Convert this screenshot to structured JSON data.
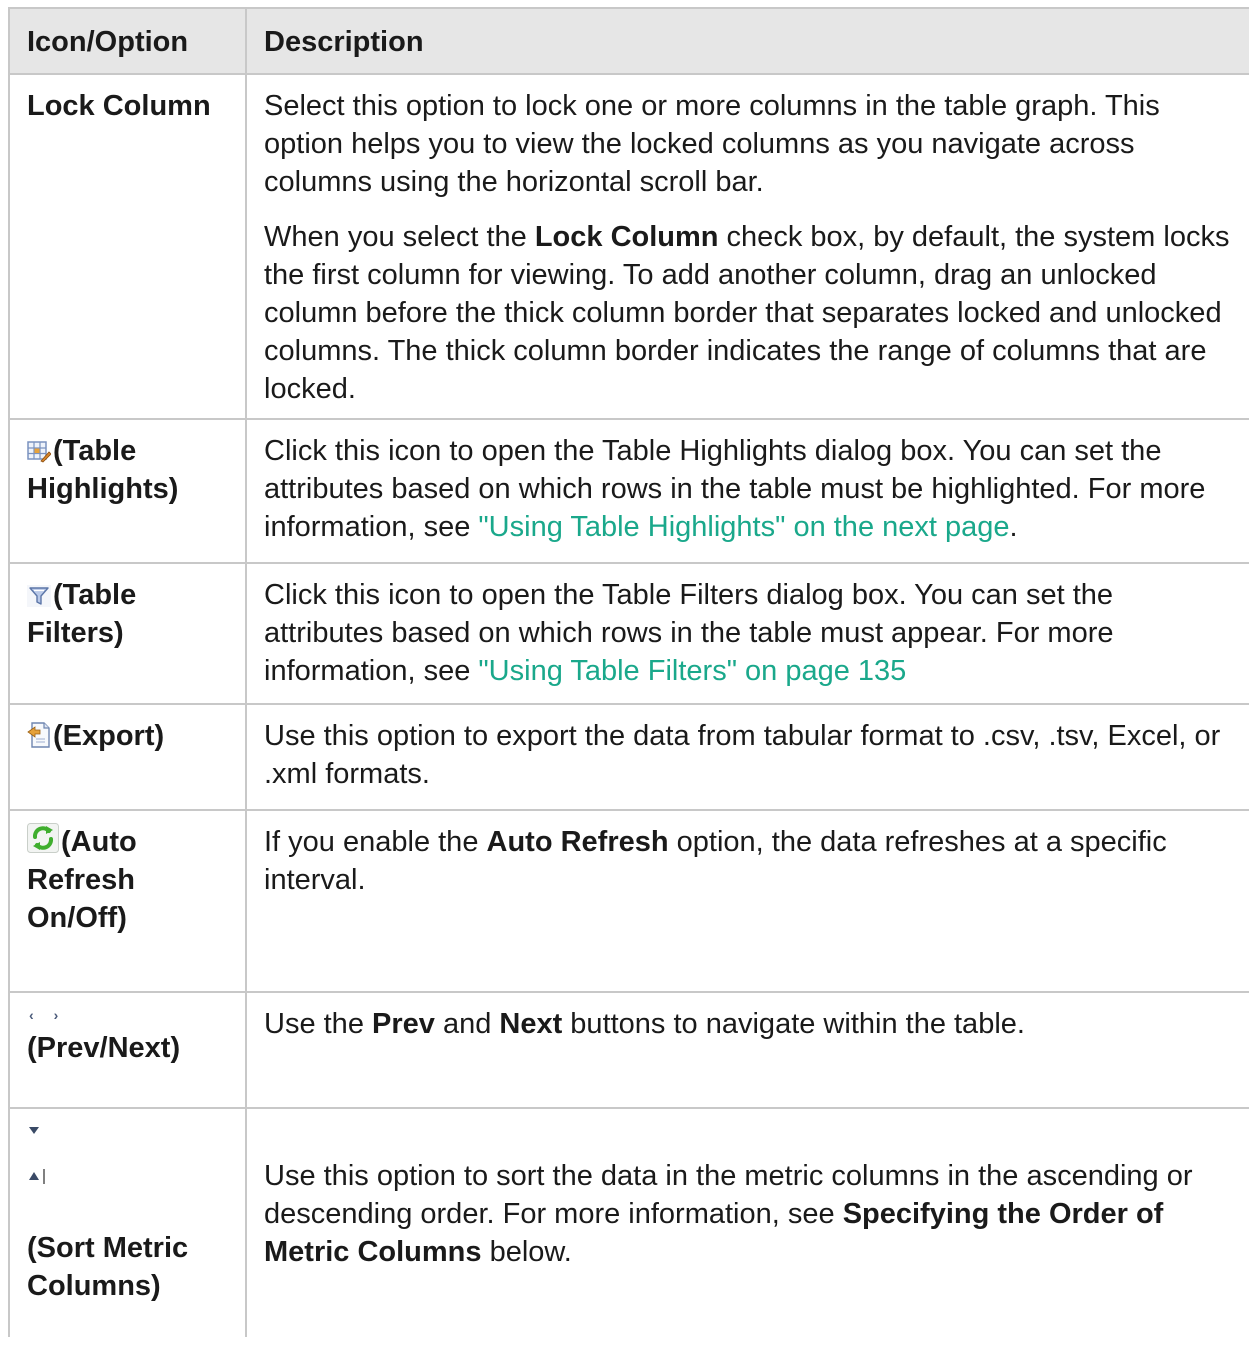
{
  "header": {
    "col1": "Icon/Option",
    "col2": "Description"
  },
  "rows": [
    {
      "option": "Lock Column",
      "p1": "Select this option to lock one or more columns in the table graph. This option helps you to view the locked columns as you navigate across columns using the horizontal scroll bar.",
      "p2_a": "When you select the ",
      "p2_b": "Lock Column",
      "p2_c": " check box, by default, the system locks the first column for viewing. To add another column, drag an unlocked column before the thick column border that separates locked and unlocked columns. The thick column border indicates the range of columns that are locked."
    },
    {
      "icon": "table-highlights-icon",
      "option_a": "(Table",
      "option_b": "Highlights)",
      "desc": "Click this icon to open the Table Highlights dialog box. You can set the attributes based on which rows in the table must be highlighted. For more information, see ",
      "link": "\"Using Table Highlights\" on the next page",
      "after": "."
    },
    {
      "icon": "table-filters-icon",
      "option_a": "(Table",
      "option_b": "Filters)",
      "desc": "Click this icon to open the Table Filters dialog box. You can set the attributes based on which rows in the table must appear. For more information, see ",
      "link": "\"Using Table Filters\" on page 135"
    },
    {
      "icon": "export-icon",
      "option": "(Export)",
      "desc": "Use this option to export the data from tabular format to .csv, .tsv, Excel, or .xml formats."
    },
    {
      "icon": "auto-refresh-icon",
      "option_a": "(Auto",
      "option_b": "Refresh",
      "option_c": "On/Off)",
      "desc_a": "If you enable the ",
      "desc_b": "Auto Refresh",
      "desc_c": " option, the data refreshes at a specific interval."
    },
    {
      "icon_prev": "‹",
      "icon_next": "›",
      "option": "(Prev/Next)",
      "desc_a": "Use the ",
      "desc_b": "Prev",
      "desc_c": " and ",
      "desc_d": "Next",
      "desc_e": " buttons to navigate within the table."
    },
    {
      "icon_desc": "sort-descending-icon",
      "icon_asc": "sort-ascending-icon",
      "option_a": "(Sort Metric",
      "option_b": "Columns)",
      "desc_a": "Use this option to sort the data in the metric columns in the ascending or descending order. For more information, see ",
      "desc_b": "Specifying the Order of Metric Columns",
      "desc_c": " below."
    }
  ],
  "colors": {
    "header_bg": "#e6e6e6",
    "border": "#c8c8c8",
    "link": "#1aa88b"
  }
}
